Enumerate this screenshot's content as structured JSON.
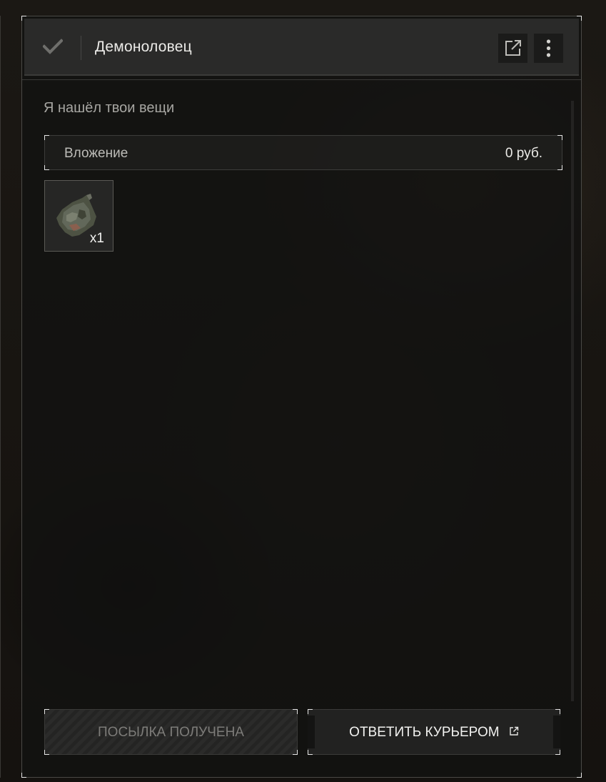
{
  "mail": {
    "sender": "Демоноловец",
    "subject": "Я нашёл твои вещи",
    "attachment_label": "Вложение",
    "attachment_value": "0  руб.",
    "item": {
      "icon": "bag-icon",
      "quantity": "x1"
    }
  },
  "header_icons": {
    "read": "checkmark-icon",
    "open_external": "external-link-icon",
    "more": "vertical-dots-icon"
  },
  "actions": {
    "received_label": "ПОСЫЛКА ПОЛУЧЕНА",
    "reply_label": "ОТВЕТИТЬ КУРЬЕРОМ"
  },
  "colors": {
    "panel_bg": "#121211",
    "header_bg": "#2a2a29",
    "text_primary": "#ecebe8",
    "text_muted": "#a7a6a2",
    "corner_accent": "#e6e6e6"
  }
}
